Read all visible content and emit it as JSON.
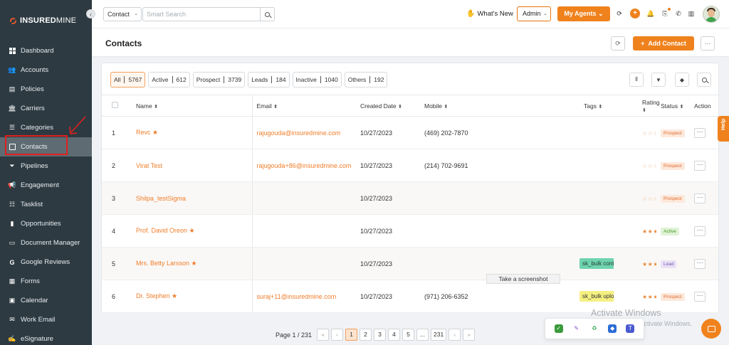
{
  "app": {
    "brand_bold": "INSURED",
    "brand_light": "MINE"
  },
  "sidebar": {
    "items": [
      {
        "label": "Dashboard",
        "icon": "dashboard-icon"
      },
      {
        "label": "Accounts",
        "icon": "accounts-icon"
      },
      {
        "label": "Policies",
        "icon": "policies-icon"
      },
      {
        "label": "Carriers",
        "icon": "carriers-icon"
      },
      {
        "label": "Categories",
        "icon": "categories-icon"
      },
      {
        "label": "Contacts",
        "icon": "contacts-icon",
        "active": true
      },
      {
        "label": "Pipelines",
        "icon": "pipelines-icon"
      },
      {
        "label": "Engagement",
        "icon": "megaphone-icon"
      },
      {
        "label": "Tasklist",
        "icon": "tasklist-icon"
      },
      {
        "label": "Opportunities",
        "icon": "opportunities-icon"
      },
      {
        "label": "Document Manager",
        "icon": "folder-icon"
      },
      {
        "label": "Google Reviews",
        "icon": "google-icon"
      },
      {
        "label": "Forms",
        "icon": "forms-icon"
      },
      {
        "label": "Calendar",
        "icon": "calendar-icon"
      },
      {
        "label": "Work Email",
        "icon": "email-icon"
      },
      {
        "label": "eSignature",
        "icon": "signature-icon"
      }
    ]
  },
  "topbar": {
    "search_scope": "Contact",
    "search_placeholder": "Smart Search",
    "whats_new": "What's New",
    "role": "Admin",
    "my_agents": "My Agents"
  },
  "page": {
    "title": "Contacts",
    "add_contact": "Add Contact"
  },
  "filters": [
    {
      "label": "All",
      "count": "5767",
      "selected": true
    },
    {
      "label": "Active",
      "count": "612"
    },
    {
      "label": "Prospect",
      "count": "3739"
    },
    {
      "label": "Leads",
      "count": "184"
    },
    {
      "label": "Inactive",
      "count": "1040"
    },
    {
      "label": "Others",
      "count": "192"
    }
  ],
  "table": {
    "headers": {
      "name": "Name",
      "email": "Email",
      "created": "Created Date",
      "mobile": "Mobile",
      "tags": "Tags",
      "rating": "Rating",
      "status": "Status",
      "action": "Action"
    },
    "rows": [
      {
        "idx": "1",
        "name": "Revc",
        "email": "rajugouda@insuredmine.com",
        "created": "10/27/2023",
        "mobile": "(469) 202-7870",
        "tag": "",
        "rating": "☆☆☆☆☆",
        "status": "Prospect"
      },
      {
        "idx": "2",
        "name": "Virat Test",
        "email": "rajugouda+86@insuredmine.com",
        "created": "10/27/2023",
        "mobile": "(214) 702-9691",
        "tag": "",
        "rating": "☆☆☆☆☆",
        "status": "Prospect"
      },
      {
        "idx": "3",
        "name": "Shilpa_testSigma",
        "email": "",
        "created": "10/27/2023",
        "mobile": "",
        "tag": "",
        "rating": "☆☆☆☆☆",
        "status": "Prospect"
      },
      {
        "idx": "4",
        "name": "Prof. David Oreon",
        "email": "",
        "created": "10/27/2023",
        "mobile": "",
        "tag": "",
        "rating": "★★★★★",
        "status": "Active"
      },
      {
        "idx": "5",
        "name": "Mrs. Betty Larsson",
        "email": "",
        "created": "10/27/2023",
        "mobile": "",
        "tag": "sk_bulk contact�",
        "rating": "★★★★★",
        "status": "Lead"
      },
      {
        "idx": "6",
        "name": "Dr. Stephen",
        "email": "suraj+11@insuredmine.com",
        "created": "10/27/2023",
        "mobile": "(971) 206-6352",
        "tag": "sk_bulk upload",
        "rating": "★★★☆☆",
        "status": "Prospect"
      }
    ]
  },
  "overlay": {
    "tooltip": "Take a screenshot",
    "activate_title": "Activate Windows",
    "activate_sub": "Go to Settings to activate Windows.",
    "help": "Help"
  },
  "pagination": {
    "label": "Page 1 / 231",
    "first": "«",
    "prev": "‹",
    "pages": [
      "1",
      "2",
      "3",
      "4",
      "5",
      "...",
      "231"
    ],
    "next": "›",
    "last": "»"
  }
}
